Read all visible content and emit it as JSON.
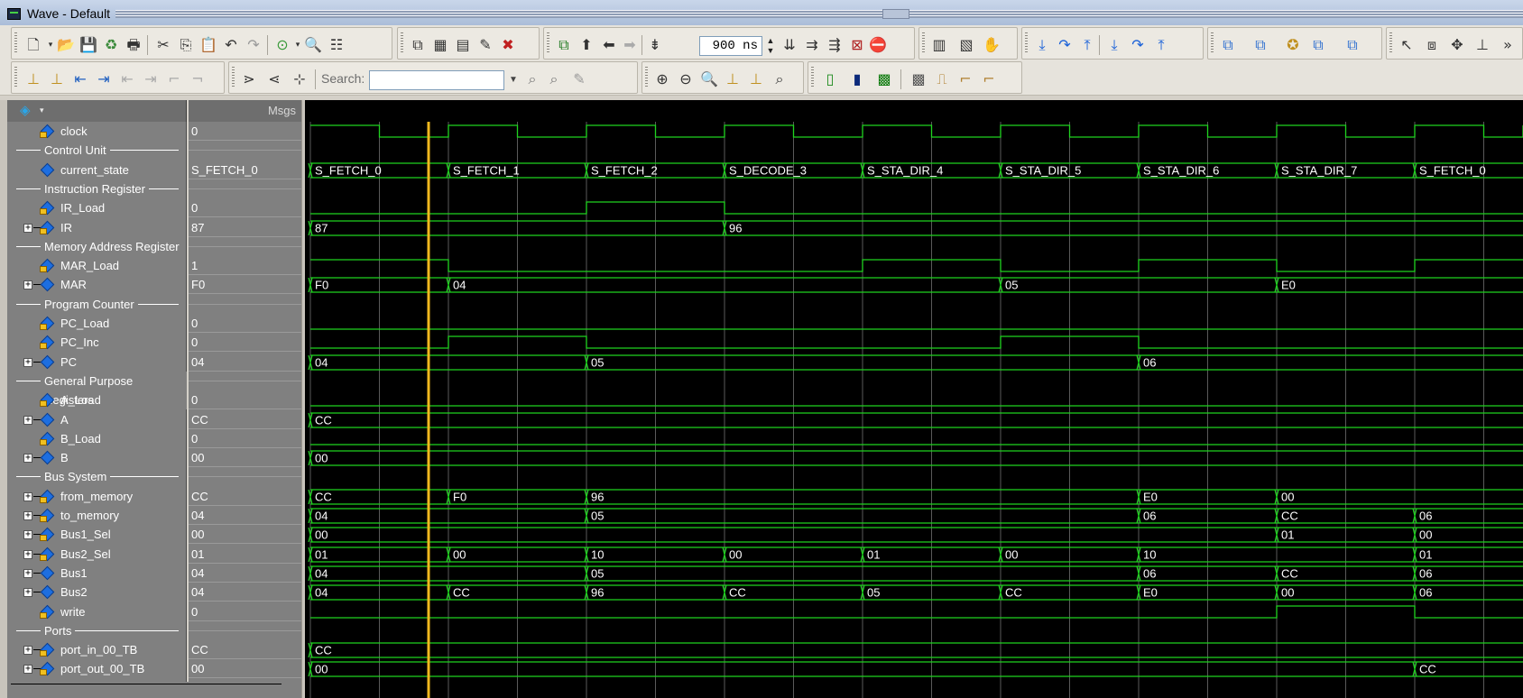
{
  "window": {
    "title": "Wave - Default"
  },
  "toolbar": {
    "zoom_value": "900 ns",
    "search_label": "Search:",
    "search_placeholder": ""
  },
  "panes": {
    "msgs_header": "Msgs"
  },
  "signals": [
    {
      "kind": "signal",
      "name": "clock",
      "value": "0",
      "expandable": false,
      "arrow": true
    },
    {
      "kind": "divider",
      "label": "Control Unit"
    },
    {
      "kind": "signal",
      "name": "current_state",
      "value": "S_FETCH_0",
      "expandable": false,
      "arrow": false
    },
    {
      "kind": "divider",
      "label": "Instruction Register"
    },
    {
      "kind": "signal",
      "name": "IR_Load",
      "value": "0",
      "expandable": false,
      "arrow": true
    },
    {
      "kind": "signal",
      "name": "IR",
      "value": "87",
      "expandable": true,
      "arrow": true
    },
    {
      "kind": "divider",
      "label": "Memory Address Register"
    },
    {
      "kind": "signal",
      "name": "MAR_Load",
      "value": "1",
      "expandable": false,
      "arrow": true
    },
    {
      "kind": "signal",
      "name": "MAR",
      "value": "F0",
      "expandable": true,
      "arrow": false
    },
    {
      "kind": "divider",
      "label": "Program Counter"
    },
    {
      "kind": "signal",
      "name": "PC_Load",
      "value": "0",
      "expandable": false,
      "arrow": true
    },
    {
      "kind": "signal",
      "name": "PC_Inc",
      "value": "0",
      "expandable": false,
      "arrow": true
    },
    {
      "kind": "signal",
      "name": "PC",
      "value": "04",
      "expandable": true,
      "arrow": false
    },
    {
      "kind": "divider",
      "label": "General Purpose Registers"
    },
    {
      "kind": "signal",
      "name": "A_Load",
      "value": "0",
      "expandable": false,
      "arrow": true
    },
    {
      "kind": "signal",
      "name": "A",
      "value": "CC",
      "expandable": true,
      "arrow": false
    },
    {
      "kind": "signal",
      "name": "B_Load",
      "value": "0",
      "expandable": false,
      "arrow": true
    },
    {
      "kind": "signal",
      "name": "B",
      "value": "00",
      "expandable": true,
      "arrow": false
    },
    {
      "kind": "divider",
      "label": "Bus System"
    },
    {
      "kind": "signal",
      "name": "from_memory",
      "value": "CC",
      "expandable": true,
      "arrow": true
    },
    {
      "kind": "signal",
      "name": "to_memory",
      "value": "04",
      "expandable": true,
      "arrow": true
    },
    {
      "kind": "signal",
      "name": "Bus1_Sel",
      "value": "00",
      "expandable": true,
      "arrow": true
    },
    {
      "kind": "signal",
      "name": "Bus2_Sel",
      "value": "01",
      "expandable": true,
      "arrow": true
    },
    {
      "kind": "signal",
      "name": "Bus1",
      "value": "04",
      "expandable": true,
      "arrow": false
    },
    {
      "kind": "signal",
      "name": "Bus2",
      "value": "04",
      "expandable": true,
      "arrow": false
    },
    {
      "kind": "signal",
      "name": "write",
      "value": "0",
      "expandable": false,
      "arrow": true
    },
    {
      "kind": "divider",
      "label": "Ports"
    },
    {
      "kind": "signal",
      "name": "port_in_00_TB",
      "value": "CC",
      "expandable": true,
      "arrow": true
    },
    {
      "kind": "signal",
      "name": "port_out_00_TB",
      "value": "00",
      "expandable": true,
      "arrow": true
    }
  ],
  "waveforms": {
    "clock": {
      "type": "clock"
    },
    "current_state": {
      "type": "bus",
      "segments": [
        [
          0,
          "S_FETCH_0"
        ],
        [
          1,
          "S_FETCH_1"
        ],
        [
          2,
          "S_FETCH_2"
        ],
        [
          3,
          "S_DECODE_3"
        ],
        [
          4,
          "S_STA_DIR_4"
        ],
        [
          5,
          "S_STA_DIR_5"
        ],
        [
          6,
          "S_STA_DIR_6"
        ],
        [
          7,
          "S_STA_DIR_7"
        ],
        [
          8,
          "S_FETCH_0"
        ]
      ]
    },
    "IR_Load": {
      "type": "bit",
      "levels": [
        0,
        0,
        1,
        0,
        0,
        0,
        0,
        0,
        0
      ]
    },
    "IR": {
      "type": "bus",
      "segments": [
        [
          0,
          "87"
        ],
        [
          3,
          "96"
        ]
      ]
    },
    "MAR_Load": {
      "type": "bit",
      "levels": [
        1,
        0,
        0,
        0,
        1,
        0,
        1,
        0,
        1
      ]
    },
    "MAR": {
      "type": "bus",
      "segments": [
        [
          0,
          "F0"
        ],
        [
          1,
          "04"
        ],
        [
          5,
          "05"
        ],
        [
          7,
          "E0"
        ]
      ]
    },
    "PC_Load": {
      "type": "bit",
      "levels": [
        0,
        0,
        0,
        0,
        0,
        0,
        0,
        0,
        0
      ]
    },
    "PC_Inc": {
      "type": "bit",
      "levels": [
        0,
        1,
        0,
        0,
        0,
        1,
        0,
        0,
        0
      ]
    },
    "PC": {
      "type": "bus",
      "segments": [
        [
          0,
          "04"
        ],
        [
          2,
          "05"
        ],
        [
          6,
          "06"
        ]
      ]
    },
    "A_Load": {
      "type": "bit",
      "levels": [
        0,
        0,
        0,
        0,
        0,
        0,
        0,
        0,
        0
      ]
    },
    "A": {
      "type": "bus",
      "segments": [
        [
          0,
          "CC"
        ]
      ]
    },
    "B_Load": {
      "type": "bit",
      "levels": [
        0,
        0,
        0,
        0,
        0,
        0,
        0,
        0,
        0
      ]
    },
    "B": {
      "type": "bus",
      "segments": [
        [
          0,
          "00"
        ]
      ]
    },
    "from_memory": {
      "type": "bus",
      "segments": [
        [
          0,
          "CC"
        ],
        [
          1,
          "F0"
        ],
        [
          2,
          "96"
        ],
        [
          6,
          "E0"
        ],
        [
          7,
          "00"
        ]
      ]
    },
    "to_memory": {
      "type": "bus",
      "segments": [
        [
          0,
          "04"
        ],
        [
          2,
          "05"
        ],
        [
          6,
          "06"
        ],
        [
          7,
          "CC"
        ],
        [
          8,
          "06"
        ]
      ]
    },
    "Bus1_Sel": {
      "type": "bus",
      "segments": [
        [
          0,
          "00"
        ],
        [
          7,
          "01"
        ],
        [
          8,
          "00"
        ]
      ]
    },
    "Bus2_Sel": {
      "type": "bus",
      "segments": [
        [
          0,
          "01"
        ],
        [
          1,
          "00"
        ],
        [
          2,
          "10"
        ],
        [
          3,
          "00"
        ],
        [
          4,
          "01"
        ],
        [
          5,
          "00"
        ],
        [
          6,
          "10"
        ],
        [
          8,
          "01"
        ]
      ]
    },
    "Bus1": {
      "type": "bus",
      "segments": [
        [
          0,
          "04"
        ],
        [
          2,
          "05"
        ],
        [
          6,
          "06"
        ],
        [
          7,
          "CC"
        ],
        [
          8,
          "06"
        ]
      ]
    },
    "Bus2": {
      "type": "bus",
      "segments": [
        [
          0,
          "04"
        ],
        [
          1,
          "CC"
        ],
        [
          2,
          "96"
        ],
        [
          3,
          "CC"
        ],
        [
          4,
          "05"
        ],
        [
          5,
          "CC"
        ],
        [
          6,
          "E0"
        ],
        [
          7,
          "00"
        ],
        [
          8,
          "06"
        ]
      ]
    },
    "write": {
      "type": "bit",
      "levels": [
        0,
        0,
        0,
        0,
        0,
        0,
        0,
        1,
        0
      ]
    },
    "port_in_00_TB": {
      "type": "bus",
      "segments": [
        [
          0,
          "CC"
        ]
      ]
    },
    "port_out_00_TB": {
      "type": "bus",
      "segments": [
        [
          0,
          "00"
        ],
        [
          8,
          "CC"
        ]
      ]
    }
  },
  "colors": {
    "wave": "#1fd31f",
    "cursor": "#f0b81e",
    "grid": "#5a5a5a",
    "background": "#000000",
    "pane": "#808080"
  }
}
